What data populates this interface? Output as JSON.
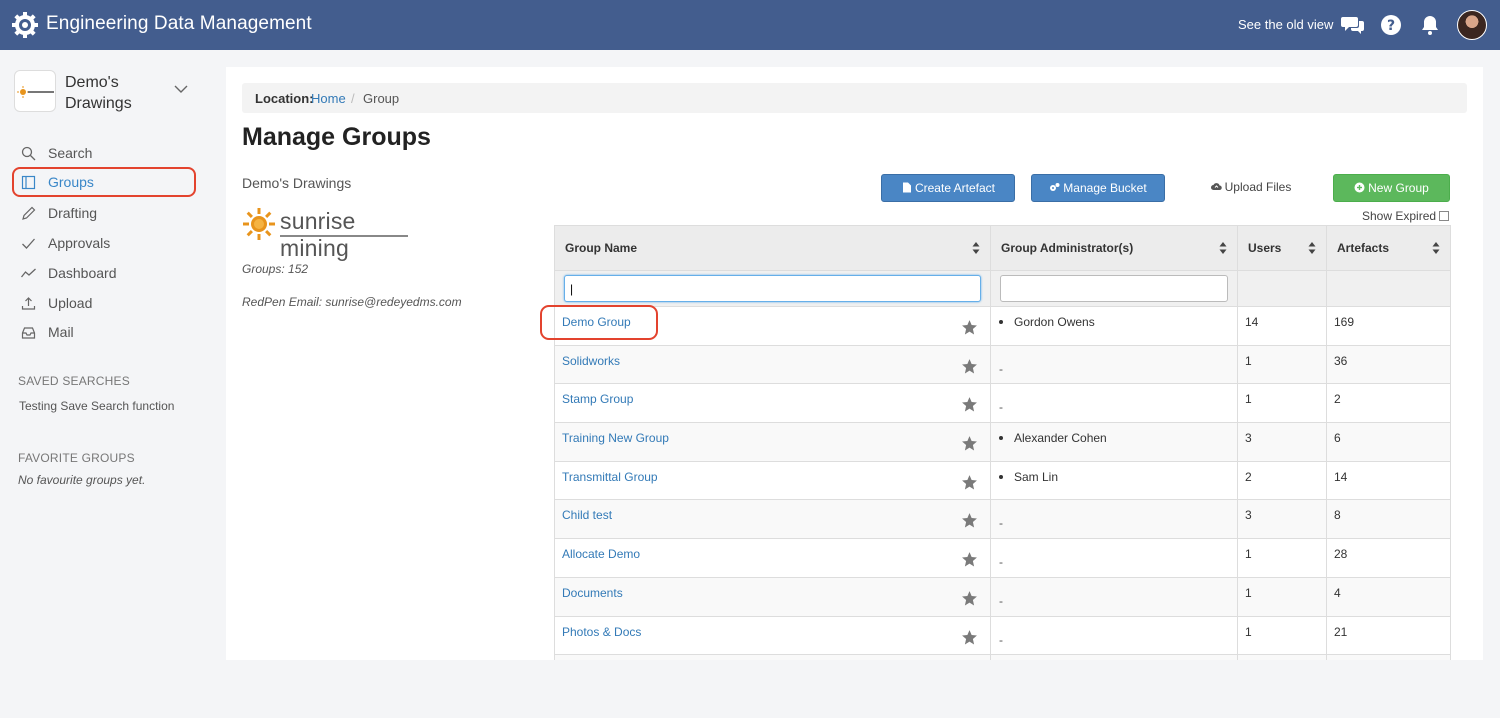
{
  "app": {
    "title": "Engineering Data Management",
    "old_view": "See the old view"
  },
  "project": {
    "name": "Demo's Drawings",
    "logo_text": "sunrise mining"
  },
  "nav": [
    {
      "label": "Search",
      "icon": "search-icon"
    },
    {
      "label": "Groups",
      "icon": "book-icon"
    },
    {
      "label": "Drafting",
      "icon": "pencil-icon"
    },
    {
      "label": "Approvals",
      "icon": "checkmark-icon"
    },
    {
      "label": "Dashboard",
      "icon": "trend-line-icon"
    },
    {
      "label": "Upload",
      "icon": "upload-icon"
    },
    {
      "label": "Mail",
      "icon": "inbox-icon"
    }
  ],
  "saved_searches": {
    "heading": "SAVED SEARCHES",
    "items": [
      "Testing Save Search function"
    ]
  },
  "favorite_groups": {
    "heading": "FAVORITE GROUPS",
    "empty": "No favourite groups yet."
  },
  "breadcrumb": {
    "location": "Location:",
    "home": "Home",
    "separator": "/",
    "current": "Group"
  },
  "page": {
    "title": "Manage Groups",
    "subtitle": "Demo's Drawings",
    "groups_count": "Groups: 152",
    "redpen_email": "RedPen Email: sunrise@redeyedms.com"
  },
  "actions": {
    "create_artefact": "Create Artefact",
    "manage_bucket": "Manage Bucket",
    "upload_files": "Upload Files",
    "new_group": "New Group",
    "show_expired": "Show Expired"
  },
  "table": {
    "columns": [
      "Group Name",
      "Group Administrator(s)",
      "Users",
      "Artefacts"
    ],
    "filter_value": "|",
    "rows": [
      {
        "name": "Demo Group",
        "admin": "Gordon Owens",
        "users": "14",
        "artefacts": "169"
      },
      {
        "name": "Solidworks",
        "admin": "-",
        "users": "1",
        "artefacts": "36"
      },
      {
        "name": "Stamp Group",
        "admin": "-",
        "users": "1",
        "artefacts": "2"
      },
      {
        "name": "Training New Group",
        "admin": "Alexander Cohen",
        "users": "3",
        "artefacts": "6"
      },
      {
        "name": "Transmittal Group",
        "admin": "Sam Lin",
        "users": "2",
        "artefacts": "14"
      },
      {
        "name": "Child test",
        "admin": "-",
        "users": "3",
        "artefacts": "8"
      },
      {
        "name": "Allocate Demo",
        "admin": "-",
        "users": "1",
        "artefacts": "28"
      },
      {
        "name": "Documents",
        "admin": "-",
        "users": "1",
        "artefacts": "4"
      },
      {
        "name": "Photos & Docs",
        "admin": "-",
        "users": "1",
        "artefacts": "21"
      }
    ]
  },
  "colors": {
    "topbar": "#435d8e",
    "link": "#337ab7",
    "primary_button": "#4a86c5",
    "success_button": "#5cb85c",
    "highlight": "#e3432e"
  }
}
